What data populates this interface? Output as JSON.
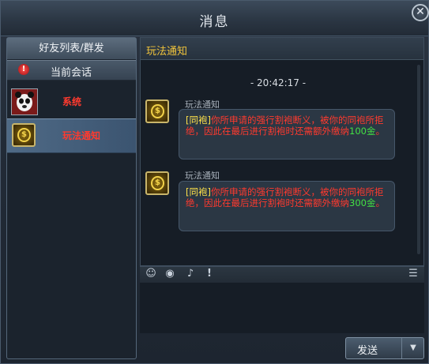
{
  "window": {
    "title": "消息",
    "close_symbol": "✕"
  },
  "sidebar": {
    "friends_tab_label": "好友列表/群发",
    "current_session_label": "当前会话",
    "conversations": [
      {
        "name": "系统",
        "icon": "system-avatar-icon",
        "selected": false
      },
      {
        "name": "玩法通知",
        "icon": "gold-coin-icon",
        "selected": true
      }
    ]
  },
  "chat": {
    "title": "玩法通知",
    "timestamp": "- 20:42:17 -",
    "messages": [
      {
        "sender": "玩法通知",
        "tag": "[同袍]",
        "text_a": "你所申请的强行割袍断义，被你的同袍所拒绝，因此在最后进行割袍时还需额外缴纳",
        "amount": "100金",
        "text_b": "。"
      },
      {
        "sender": "玩法通知",
        "tag": "[同袍]",
        "text_a": "你所申请的强行割袍断义，被你的同袍所拒绝，因此在最后进行割袍时还需额外缴纳",
        "amount": "300金",
        "text_b": "。"
      }
    ]
  },
  "toolbar": {
    "icons": [
      "emoji-icon",
      "game-icon",
      "microphone-icon",
      "exclamation-icon",
      "menu-list-icon"
    ]
  },
  "send": {
    "label": "发送",
    "dropdown_symbol": "▼"
  },
  "colors": {
    "accent_title": "#f1c43b",
    "message_text": "#ff3a2e",
    "tag": "#ffe24a",
    "amount": "#43e043"
  }
}
